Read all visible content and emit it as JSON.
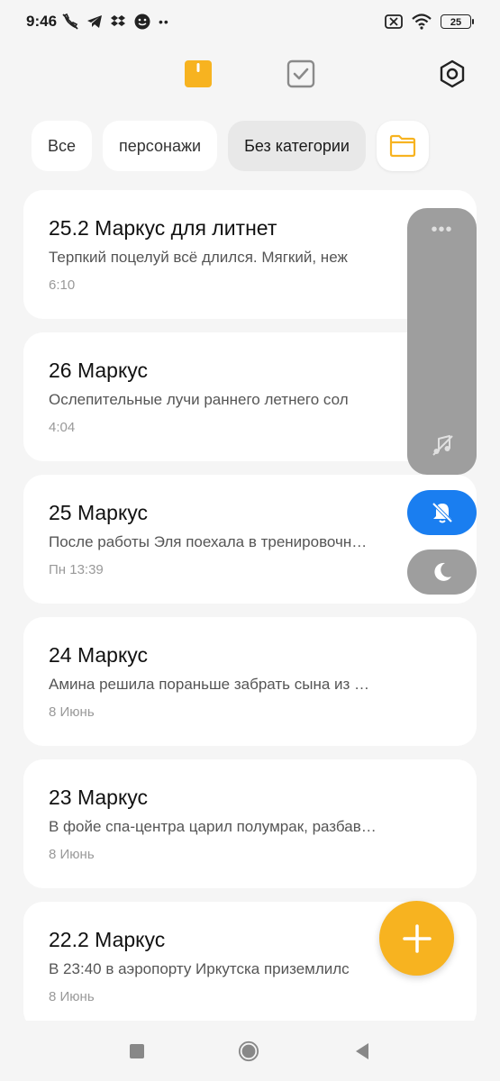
{
  "status_bar": {
    "time": "9:46",
    "battery": "25",
    "icons": [
      "muted-call-icon",
      "telegram-icon",
      "dropbox-icon",
      "face-icon",
      "more-dots-icon",
      "sim-off-icon",
      "wifi-icon",
      "battery-icon"
    ]
  },
  "top_nav": {
    "tabs": [
      "notes-tab-icon",
      "tasks-tab-icon"
    ],
    "active_color": "#f7b320"
  },
  "filters": {
    "chips": [
      {
        "label": "Все"
      },
      {
        "label": "персонажи"
      },
      {
        "label": "Без категории"
      }
    ],
    "active_index": 2,
    "folder_icon": "folder-icon"
  },
  "notes": [
    {
      "title": "25.2 Маркус для литнет",
      "preview": "Терпкий поцелуй всё длился. Мягкий, неж",
      "date": "6:10"
    },
    {
      "title": "26 Маркус",
      "preview": "Ослепительные лучи раннего летнего сол",
      "date": "4:04"
    },
    {
      "title": "25 Маркус",
      "preview": "После работы Эля поехала в тренировочн…",
      "date": "Пн 13:39"
    },
    {
      "title": "24 Маркус",
      "preview": "Амина решила пораньше забрать сына из …",
      "date": "8 Июнь"
    },
    {
      "title": "23 Маркус",
      "preview": "В фойе спа-центра царил полумрак, разбав…",
      "date": "8 Июнь"
    },
    {
      "title": "22.2 Маркус",
      "preview": "В 23:40 в аэропорту Иркутска приземлилс",
      "date": "8 Июнь"
    }
  ],
  "float_panel": {
    "dots": "•••",
    "music_icon": "music-off-icon",
    "bell_icon": "bell-off-icon",
    "moon_icon": "moon-icon",
    "bell_color": "#1a7ef0"
  },
  "fab": {
    "icon": "plus-icon",
    "color": "#f7b320"
  },
  "bottom_nav": {
    "icons": [
      "recent-apps-icon",
      "home-icon",
      "back-icon"
    ]
  }
}
